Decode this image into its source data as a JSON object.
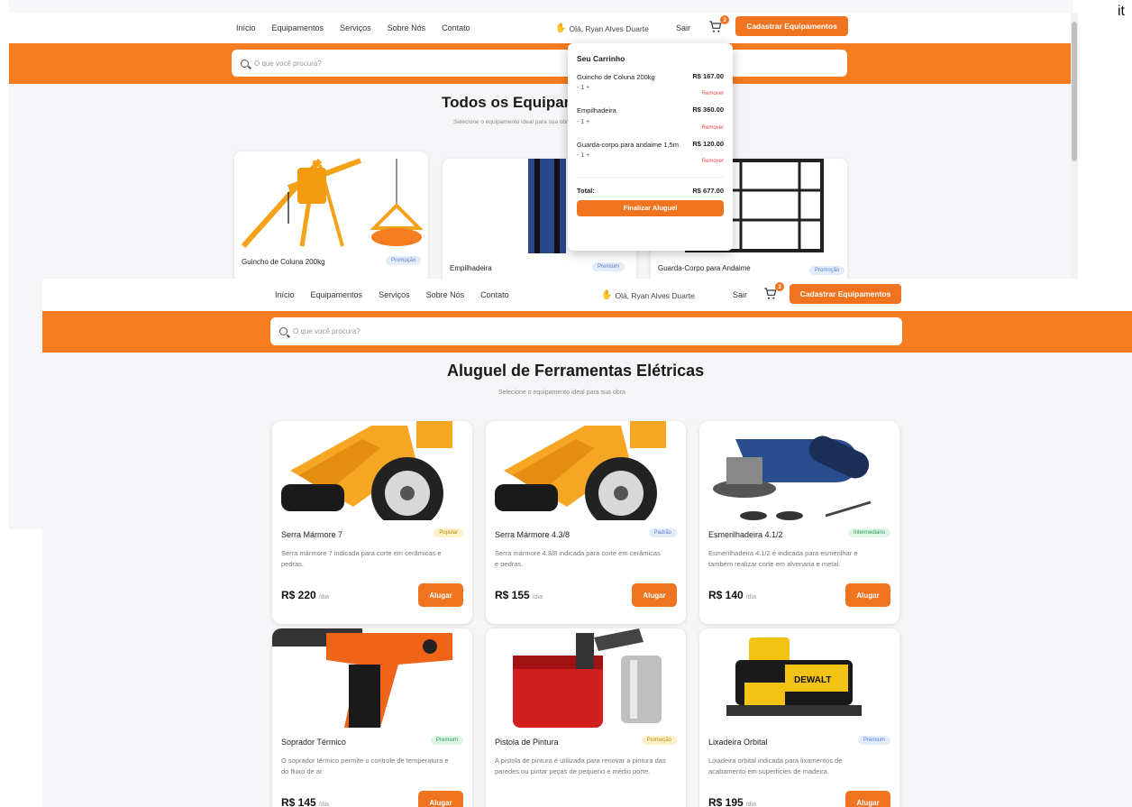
{
  "corner_text": "it",
  "nav": {
    "items": [
      "Início",
      "Equipamentos",
      "Serviços",
      "Sobre Nós",
      "Contato"
    ],
    "greeting": "Olá, Ryan Alves Duarte",
    "logout": "Sair",
    "cart_count": "3",
    "cta": "Cadastrar Equipamentos",
    "search_placeholder": "O que você procura?"
  },
  "shot1": {
    "title": "Todos os Equipamentos",
    "subtitle": "Selecione o equipamento ideal para sua obra",
    "cards": [
      {
        "name": "Guincho de Coluna 200kg",
        "tag": "Promoção",
        "tag_color": "blue"
      },
      {
        "name": "Empilhadeira",
        "tag": "Premium",
        "tag_color": "blue"
      },
      {
        "name": "Guarda-Corpo para Andaime",
        "tag": "Promoção",
        "tag_color": "blue"
      }
    ]
  },
  "cart": {
    "title": "Seu Carrinho",
    "items": [
      {
        "name": "Guincho de Coluna 200kg",
        "price": "R$ 167.00",
        "qty": "1",
        "remove": "Remover"
      },
      {
        "name": "Empilhadeira",
        "price": "R$ 360.00",
        "qty": "1",
        "remove": "Remover"
      },
      {
        "name": "Guarda-corpo para andaime 1,5m",
        "price": "R$ 120.00",
        "qty": "1",
        "remove": "Remover"
      }
    ],
    "total_label": "Total:",
    "total_value": "R$ 677.00",
    "checkout": "Finalizar Aluguel"
  },
  "shot2": {
    "title": "Aluguel de Ferramentas Elétricas",
    "subtitle": "Selecione o equipamento ideal para sua obra",
    "cards": [
      {
        "name": "Serra Mármore 7",
        "tag": "Popular",
        "tag_color": "yellow",
        "desc": "Serra mármore 7 indicada para corte em cerâmicas e pedras.",
        "price": "R$ 220",
        "unit": "/dia",
        "button": "Alugar",
        "img": "saw"
      },
      {
        "name": "Serra Mármore 4.3/8",
        "tag": "Padrão",
        "tag_color": "blue",
        "desc": "Serra mármore 4.3/8 indicada para corte em cerâmicas e pedras.",
        "price": "R$ 155",
        "unit": "/dia",
        "button": "Alugar",
        "img": "saw"
      },
      {
        "name": "Esmerilhadeira 4.1/2",
        "tag": "Intermediário",
        "tag_color": "green",
        "desc": "Esmerilhadeira 4.1/2 é indicada para esmerilhar e também realizar corte em alvenaria e metal.",
        "price": "R$ 140",
        "unit": "/dia",
        "button": "Alugar",
        "img": "grinder"
      },
      {
        "name": "Soprador Térmico",
        "tag": "Premium",
        "tag_color": "green",
        "desc": "O soprador térmico permite o controle de temperatura e do fluxo de ar.",
        "price": "R$ 145",
        "unit": "/dia",
        "button": "Alugar",
        "img": "heatgun"
      },
      {
        "name": "Pistola de Pintura",
        "tag": "Promoção",
        "tag_color": "yellow",
        "desc": "A pistola de pintura é utilizada para renovar a pintura das paredes ou pintar peças de pequeno e médio porte.",
        "price": "",
        "unit": "",
        "button": "",
        "img": "spray"
      },
      {
        "name": "Lixadeira Orbital",
        "tag": "Premium",
        "tag_color": "blue",
        "desc": "Lixadeira orbital indicada para lixamentos de acabamento em superfícies de madeira.",
        "price": "R$ 195",
        "unit": "/dia",
        "button": "Alugar",
        "img": "sander"
      }
    ]
  }
}
